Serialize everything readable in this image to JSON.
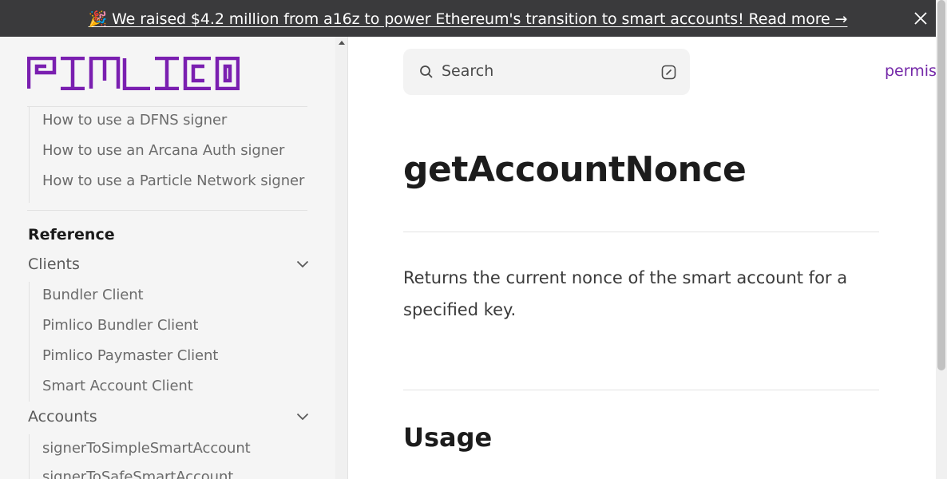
{
  "banner": {
    "text": "🎉 We raised $4.2 million from a16z to power Ethereum's transition to smart accounts! Read more →"
  },
  "logo": {
    "text": "PIMLICO",
    "color": "#7a1fb0"
  },
  "sidebar": {
    "signer_items": [
      {
        "label": "How to use a DFNS signer"
      },
      {
        "label": "How to use an Arcana Auth signer"
      },
      {
        "label": "How to use a Particle Network signer"
      }
    ],
    "section_heading": "Reference",
    "groups": [
      {
        "label": "Clients",
        "items": [
          {
            "label": "Bundler Client"
          },
          {
            "label": "Pimlico Bundler Client"
          },
          {
            "label": "Pimlico Paymaster Client"
          },
          {
            "label": "Smart Account Client"
          }
        ]
      },
      {
        "label": "Accounts",
        "items": [
          {
            "label": "signerToSimpleSmartAccount"
          },
          {
            "label": "signerToSafeSmartAccount"
          }
        ]
      }
    ]
  },
  "search": {
    "placeholder": "Search"
  },
  "top_nav": {
    "link": "permis"
  },
  "main": {
    "title": "getAccountNonce",
    "description": "Returns the current nonce of the smart account for a specified key.",
    "section_title": "Usage"
  },
  "colors": {
    "accent": "#7428a8",
    "banner_bg": "#3a3a3c",
    "sidebar_bg": "#f5f5f5"
  }
}
